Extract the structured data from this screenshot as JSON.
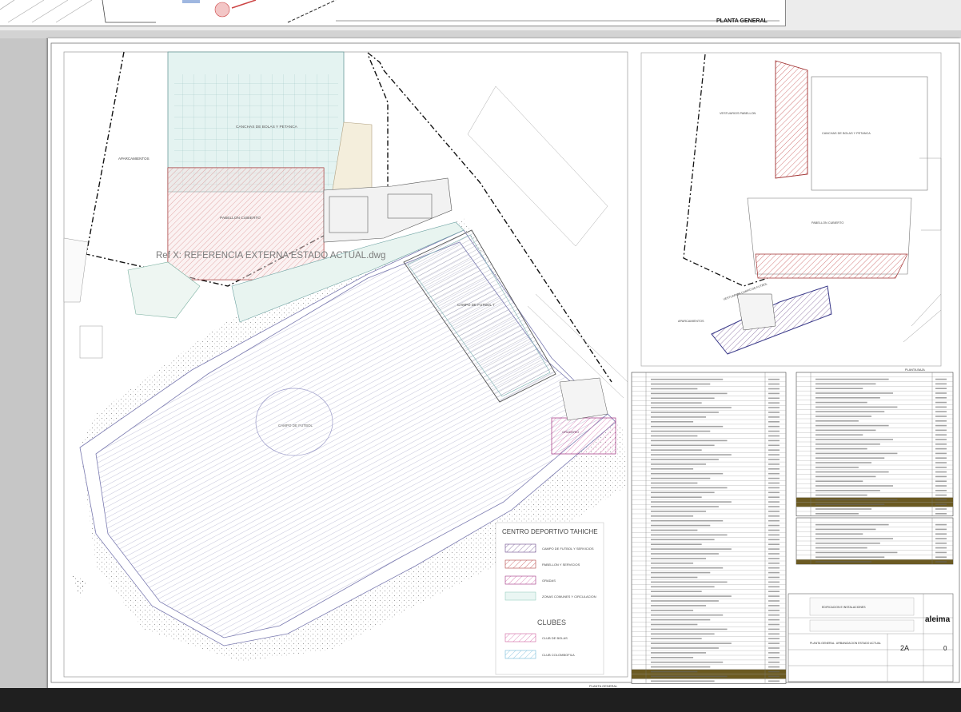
{
  "top_sheet": {
    "label": "PLANTA GENERAL"
  },
  "main_plan": {
    "xref_text": "Ref X: REFERENCIA EXTERNA ESTADO ACTUAL.dwg",
    "labels": {
      "canchas": "CANCHAS DE BOLAS Y PETANCA",
      "pabellon": "PABELLON CUBIERTO",
      "campo_futbol": "CAMPO DE FUTBOL",
      "campo_futbol_7": "CAMPO DE FUTBOL 7",
      "aparcamientos": "APARCAMIENTOS",
      "graderio": "GRADERIO"
    },
    "footer": "PLANTA GENERAL"
  },
  "legend": {
    "title": "CENTRO DEPORTIVO TAHICHE",
    "items": [
      {
        "label": "CAMPO DE FUTBOL Y SERVICIOS",
        "color": "#6a4a8a"
      },
      {
        "label": "PABELLON Y SERVICIOS",
        "color": "#b04040"
      },
      {
        "label": "GRADAS",
        "color": "#a03080"
      },
      {
        "label": "ZONAS COMUNES Y CIRCULACION",
        "color": "#9ad0c0"
      }
    ],
    "clubs_title": "CLUBES",
    "clubs": [
      {
        "label": "CLUB DE BOLAS",
        "color": "#d060a0"
      },
      {
        "label": "CLUB COLOMBOFILA",
        "color": "#70b8d8"
      }
    ]
  },
  "upper_plan": {
    "labels": {
      "vestuarios_pabellon": "VESTUARIOS PABELLON",
      "canchas": "CANCHAS DE BOLAS Y PETANCA",
      "pabellon": "PABELLON CUBIERTO",
      "vestuarios_futbol": "VESTUARIOS CAMPO DE FUTBOL",
      "aparcamientos": "APARCAMIENTOS"
    },
    "footer": "PLANTA BAJA"
  },
  "title_block": {
    "logo": "aleima",
    "sheet_number": "2A",
    "revision": "0",
    "project_label": "EDIFICACION E INSTALACIONES",
    "drawing_title": "PLANTA GENERAL. URBANIZACION ESTADO ACTUAL"
  }
}
